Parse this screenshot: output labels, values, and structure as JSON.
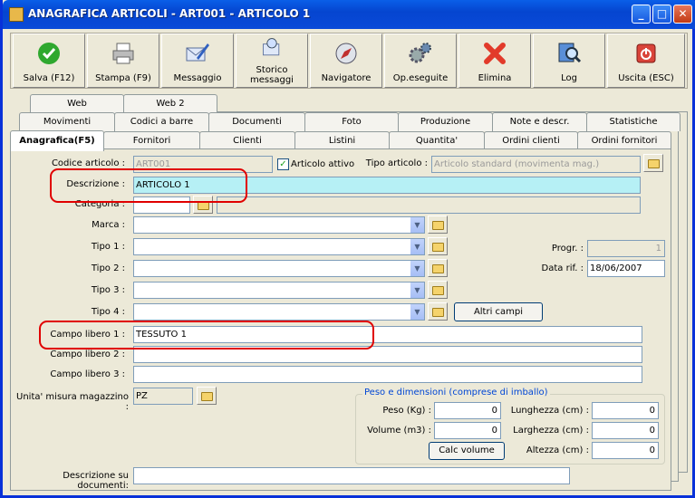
{
  "window": {
    "title": "ANAGRAFICA ARTICOLI - ART001 - ARTICOLO 1",
    "minimize": "_",
    "maximize": "□",
    "close": "✕"
  },
  "toolbar": [
    {
      "label": "Salva (F12)",
      "icon": "check-icon"
    },
    {
      "label": "Stampa (F9)",
      "icon": "printer-icon"
    },
    {
      "label": "Messaggio",
      "icon": "message-pen-icon"
    },
    {
      "label": "Storico messaggi",
      "icon": "message-search-icon"
    },
    {
      "label": "Navigatore",
      "icon": "compass-icon"
    },
    {
      "label": "Op.eseguite",
      "icon": "gears-icon"
    },
    {
      "label": "Elimina",
      "icon": "delete-x-icon"
    },
    {
      "label": "Log",
      "icon": "log-search-icon"
    },
    {
      "label": "Uscita (ESC)",
      "icon": "exit-icon"
    }
  ],
  "tabs": {
    "row1": [
      "Web",
      "Web 2"
    ],
    "row2": [
      "Movimenti",
      "Codici a barre",
      "Documenti",
      "Foto",
      "Produzione",
      "Note e descr.",
      "Statistiche"
    ],
    "row3": [
      "Anagrafica(F5)",
      "Fornitori",
      "Clienti",
      "Listini",
      "Quantita'",
      "Ordini clienti",
      "Ordini fornitori"
    ]
  },
  "form": {
    "codice_label": "Codice articolo :",
    "codice_value": "ART001",
    "attivo_label": "Articolo attivo",
    "attivo_checked": "✓",
    "tipo_articolo_label": "Tipo articolo :",
    "tipo_articolo_value": "Articolo standard (movimenta mag.)",
    "descrizione_label": "Descrizione :",
    "descrizione_value": "ARTICOLO 1",
    "categoria_label": "Categoria :",
    "categoria_value": "",
    "marca_label": "Marca :",
    "tipo1_label": "Tipo 1 :",
    "tipo2_label": "Tipo 2 :",
    "tipo3_label": "Tipo 3 :",
    "tipo4_label": "Tipo 4 :",
    "progr_label": "Progr. :",
    "progr_value": "1",
    "data_rif_label": "Data rif. :",
    "data_rif_value": "18/06/2007",
    "altri_campi": "Altri campi",
    "campo1_label": "Campo libero 1 :",
    "campo1_value": "TESSUTO 1",
    "campo2_label": "Campo libero 2 :",
    "campo2_value": "",
    "campo3_label": "Campo libero 3 :",
    "campo3_value": "",
    "um_label": "Unita' misura magazzino :",
    "um_value": "PZ",
    "desc_doc_label": "Descrizione su documenti:",
    "desc_doc_value": ""
  },
  "peso": {
    "title": "Peso e dimensioni (comprese di imballo)",
    "peso_label": "Peso (Kg) :",
    "peso_value": "0",
    "volume_label": "Volume (m3) :",
    "volume_value": "0",
    "calc": "Calc volume",
    "lunghezza_label": "Lunghezza (cm) :",
    "lunghezza_value": "0",
    "larghezza_label": "Larghezza (cm) :",
    "larghezza_value": "0",
    "altezza_label": "Altezza (cm) :",
    "altezza_value": "0"
  },
  "dropdown_glyph": "▼",
  "colors": {
    "title_bar": "#0A5FE8",
    "highlight_field": "#B6F0F5",
    "annotation_ring": "#E00000"
  }
}
